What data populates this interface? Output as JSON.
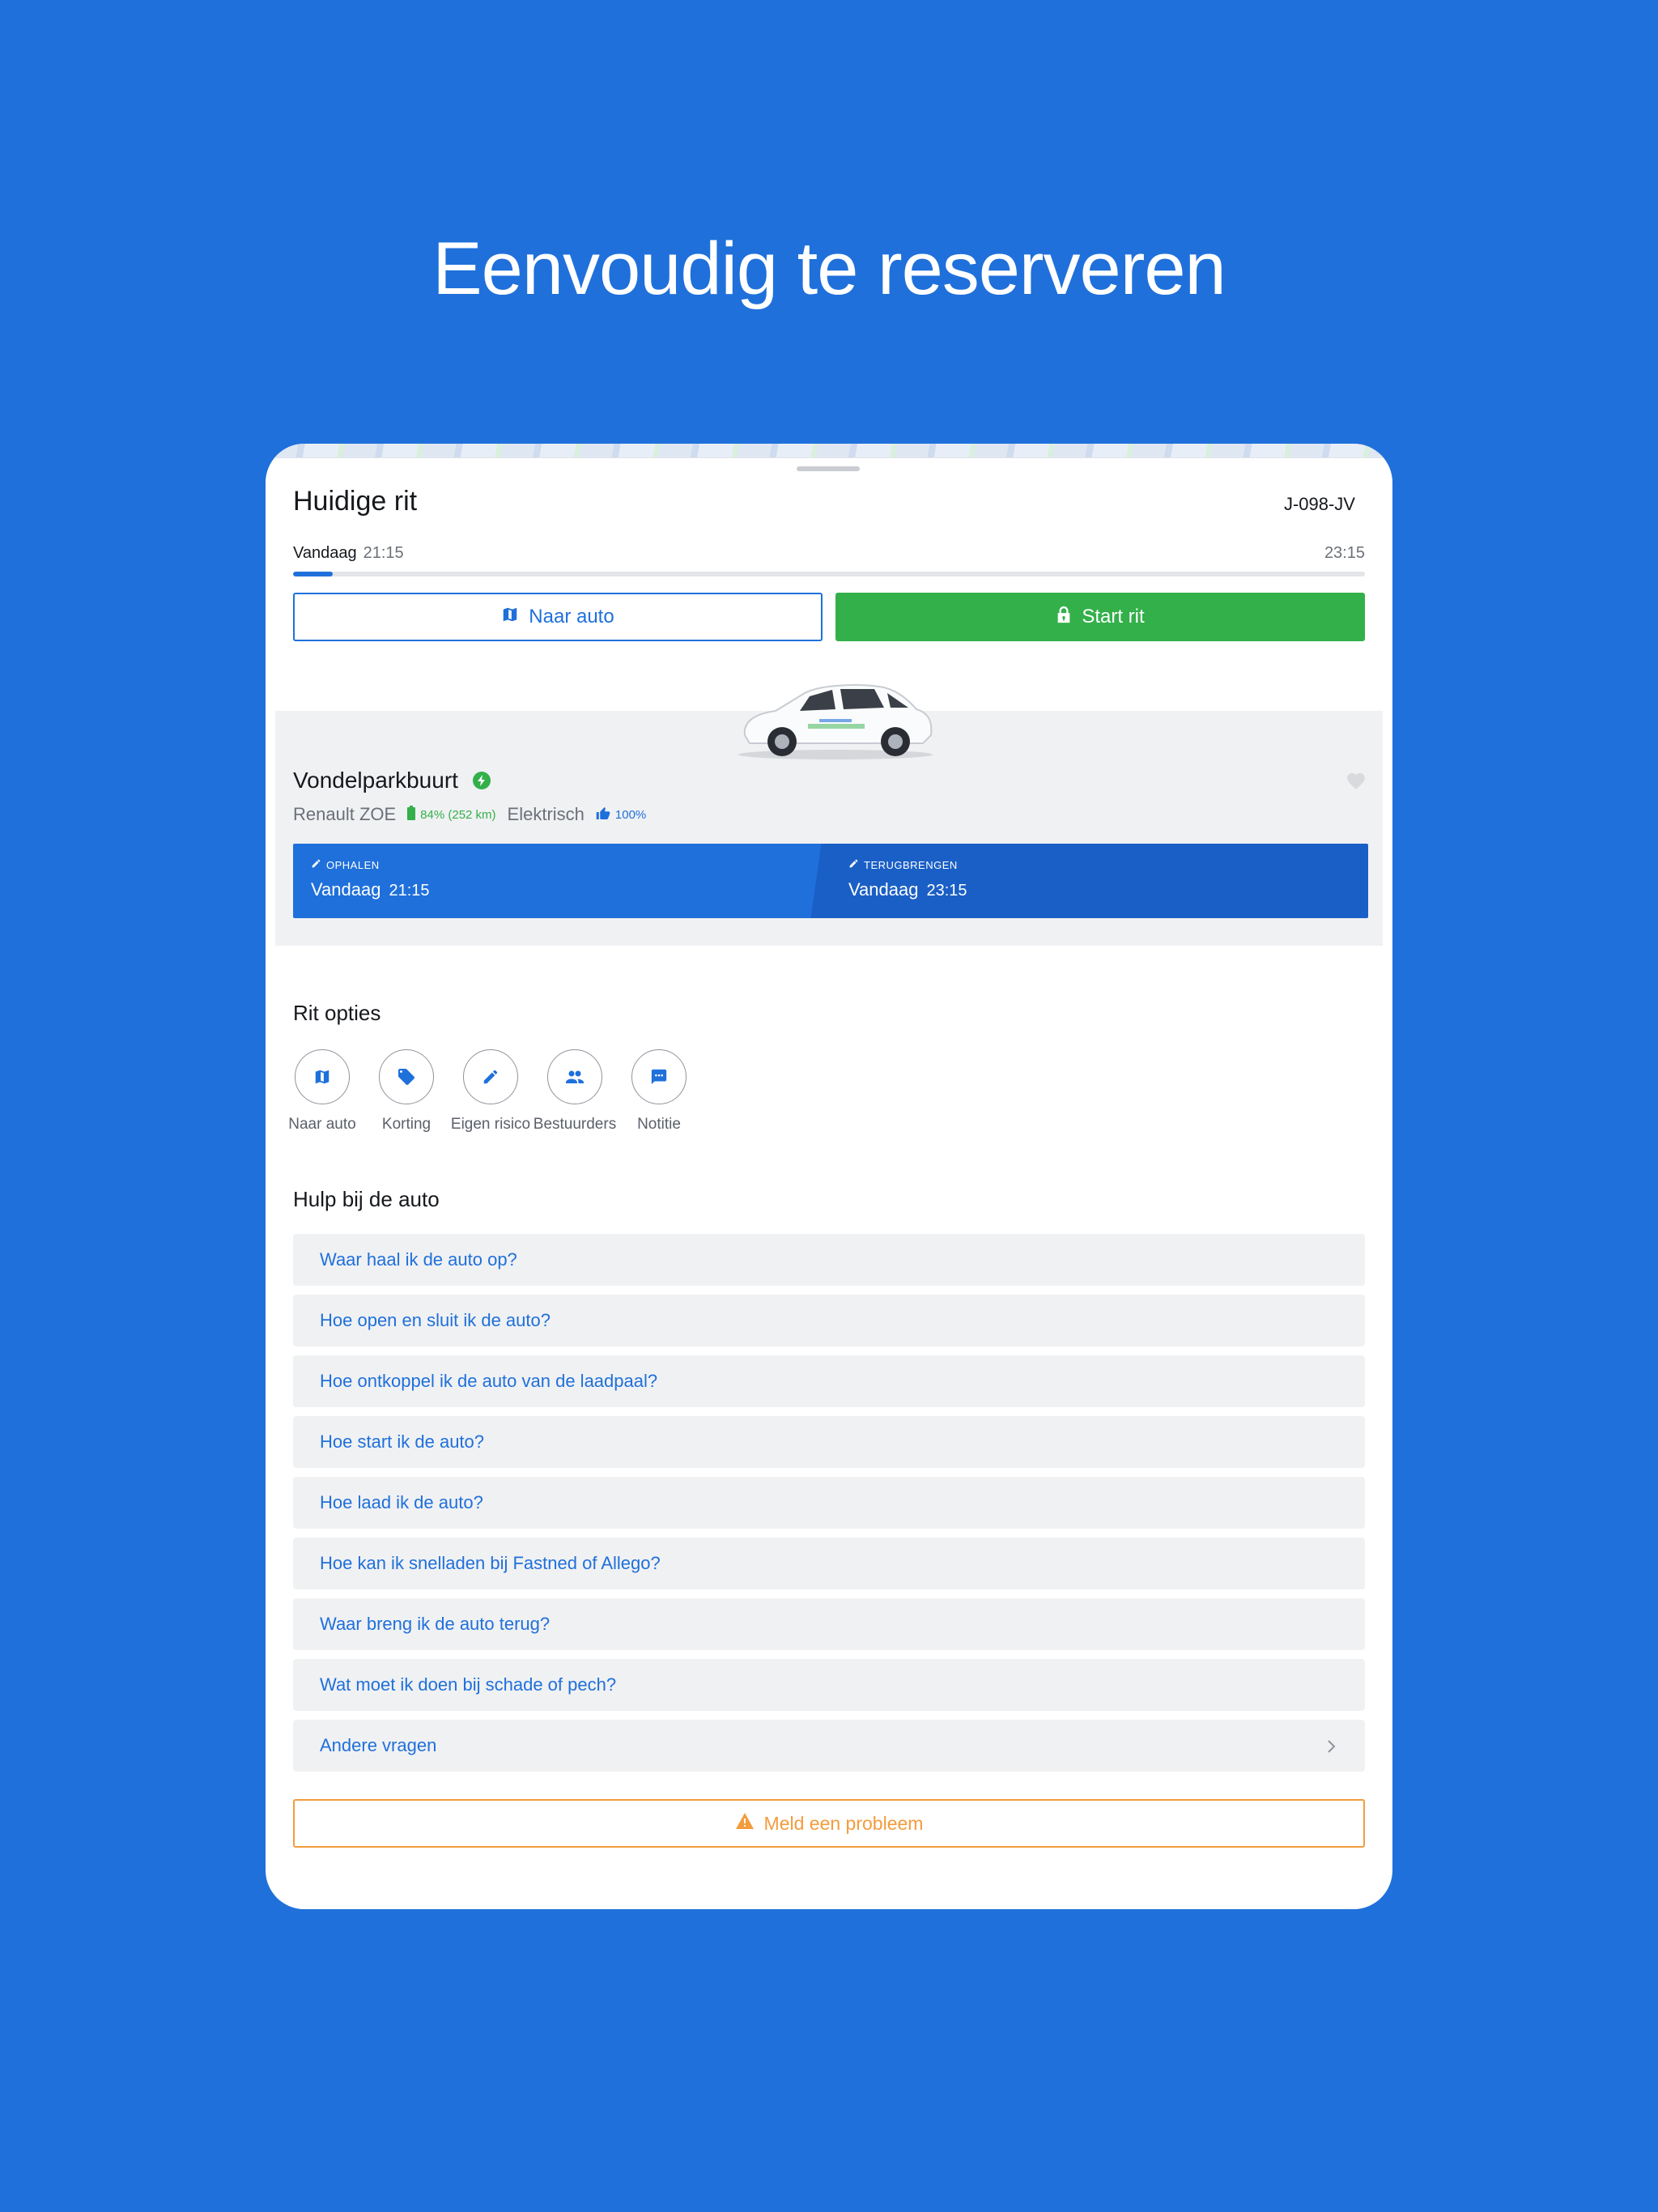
{
  "headline": "Eenvoudig te reserveren",
  "trip": {
    "title": "Huidige rit",
    "plate": "J-098-JV",
    "start_day": "Vandaag",
    "start_time": "21:15",
    "end_time": "23:15",
    "progress_fraction": 0.037
  },
  "actions": {
    "navigate_label": "Naar auto",
    "start_label": "Start rit"
  },
  "car": {
    "location": "Vondelparkbuurt",
    "model": "Renault ZOE",
    "battery": "84% (252 km)",
    "fuel": "Elektrisch",
    "rating": "100%",
    "pickup_label": "OPHALEN",
    "pickup_day": "Vandaag",
    "pickup_time": "21:15",
    "return_label": "TERUGBRENGEN",
    "return_day": "Vandaag",
    "return_time": "23:15"
  },
  "ride_options": {
    "title": "Rit opties",
    "items": [
      {
        "label": "Naar auto",
        "icon": "map-icon"
      },
      {
        "label": "Korting",
        "icon": "tag-icon"
      },
      {
        "label": "Eigen risico",
        "icon": "pencil-icon"
      },
      {
        "label": "Bestuurders",
        "icon": "people-icon"
      },
      {
        "label": "Notitie",
        "icon": "chat-icon"
      }
    ]
  },
  "help": {
    "title": "Hulp bij de auto",
    "items": [
      "Waar haal ik de auto op?",
      "Hoe open en sluit ik de auto?",
      "Hoe ontkoppel ik de auto van de laadpaal?",
      "Hoe start ik de auto?",
      "Hoe laad ik de auto?",
      "Hoe kan ik snelladen bij Fastned of Allego?",
      "Waar breng ik de auto terug?",
      "Wat moet ik doen bij schade of pech?",
      "Andere vragen"
    ]
  },
  "report_label": "Meld een probleem",
  "colors": {
    "brand_blue": "#1f70db",
    "green": "#33b04a",
    "warning_orange": "#f39c3d"
  }
}
